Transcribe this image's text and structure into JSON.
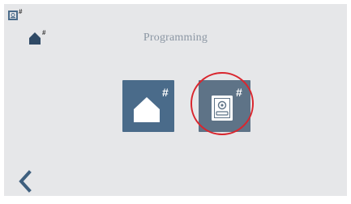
{
  "header": {
    "title": "Programming"
  },
  "status_icons": [
    {
      "icon": "intercom-icon",
      "badge": "#"
    },
    {
      "icon": "home-icon",
      "badge": "#"
    }
  ],
  "menu": {
    "items": [
      {
        "icon": "home-icon",
        "badge": "#"
      },
      {
        "icon": "intercom-panel-icon",
        "badge": "#",
        "highlighted": true
      }
    ]
  },
  "navigation": {
    "back_icon": "chevron-left-icon"
  },
  "colors": {
    "background": "#e6e7e9",
    "tile": "#4a6b8a",
    "tile_selected": "#5e7387",
    "highlight": "#d9262e",
    "title_text": "#8b96a3",
    "back_arrow": "#3e5f7e"
  }
}
